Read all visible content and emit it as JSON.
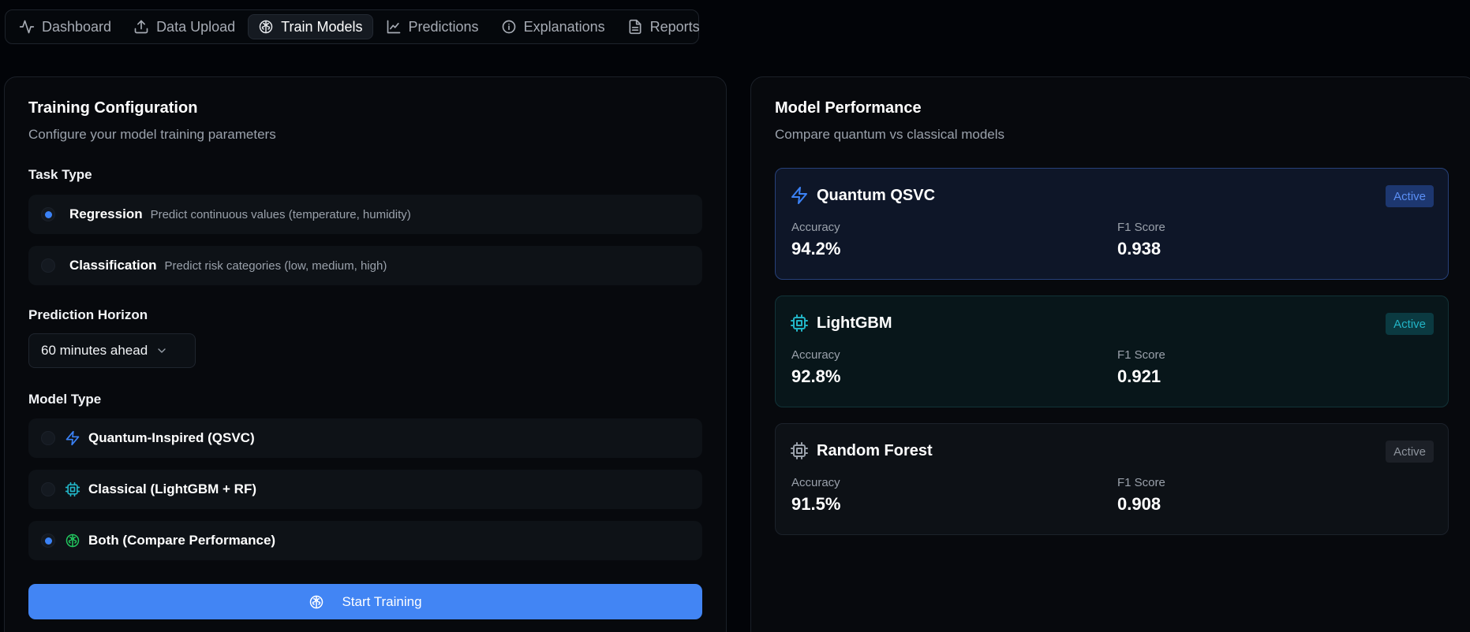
{
  "nav": {
    "items": [
      {
        "label": "Dashboard",
        "icon": "activity-icon",
        "active": false
      },
      {
        "label": "Data Upload",
        "icon": "upload-icon",
        "active": false
      },
      {
        "label": "Train Models",
        "icon": "brain-icon",
        "active": true
      },
      {
        "label": "Predictions",
        "icon": "line-chart-icon",
        "active": false
      },
      {
        "label": "Explanations",
        "icon": "info-icon",
        "active": false
      },
      {
        "label": "Reports",
        "icon": "file-text-icon",
        "active": false
      }
    ]
  },
  "config": {
    "title": "Training Configuration",
    "subtitle": "Configure your model training parameters",
    "task_type_label": "Task Type",
    "task_types": [
      {
        "title": "Regression",
        "desc": "Predict continuous values (temperature, humidity)",
        "selected": true
      },
      {
        "title": "Classification",
        "desc": "Predict risk categories (low, medium, high)",
        "selected": false
      }
    ],
    "horizon_label": "Prediction Horizon",
    "horizon_value": "60 minutes ahead",
    "model_type_label": "Model Type",
    "model_types": [
      {
        "title": "Quantum-Inspired (QSVC)",
        "icon": "zap-icon",
        "selected": false
      },
      {
        "title": "Classical (LightGBM + RF)",
        "icon": "cpu-icon",
        "selected": false
      },
      {
        "title": "Both (Compare Performance)",
        "icon": "brain-icon",
        "selected": true
      }
    ],
    "start_button": "Start Training"
  },
  "performance": {
    "title": "Model Performance",
    "subtitle": "Compare quantum vs classical models",
    "models": [
      {
        "name": "Quantum QSVC",
        "icon": "zap-icon",
        "badge": "Active",
        "accuracy_label": "Accuracy",
        "accuracy": "94.2%",
        "f1_label": "F1 Score",
        "f1": "0.938"
      },
      {
        "name": "LightGBM",
        "icon": "cpu-icon",
        "badge": "Active",
        "accuracy_label": "Accuracy",
        "accuracy": "92.8%",
        "f1_label": "F1 Score",
        "f1": "0.921"
      },
      {
        "name": "Random Forest",
        "icon": "cpu-icon",
        "badge": "Active",
        "accuracy_label": "Accuracy",
        "accuracy": "91.5%",
        "f1_label": "F1 Score",
        "f1": "0.908"
      }
    ]
  },
  "colors": {
    "accent": "#4285f4",
    "quantum": "#3b82f6",
    "lightgbm": "#22b4c6",
    "brain_green": "#22c55e",
    "muted": "#9aa1ab"
  }
}
